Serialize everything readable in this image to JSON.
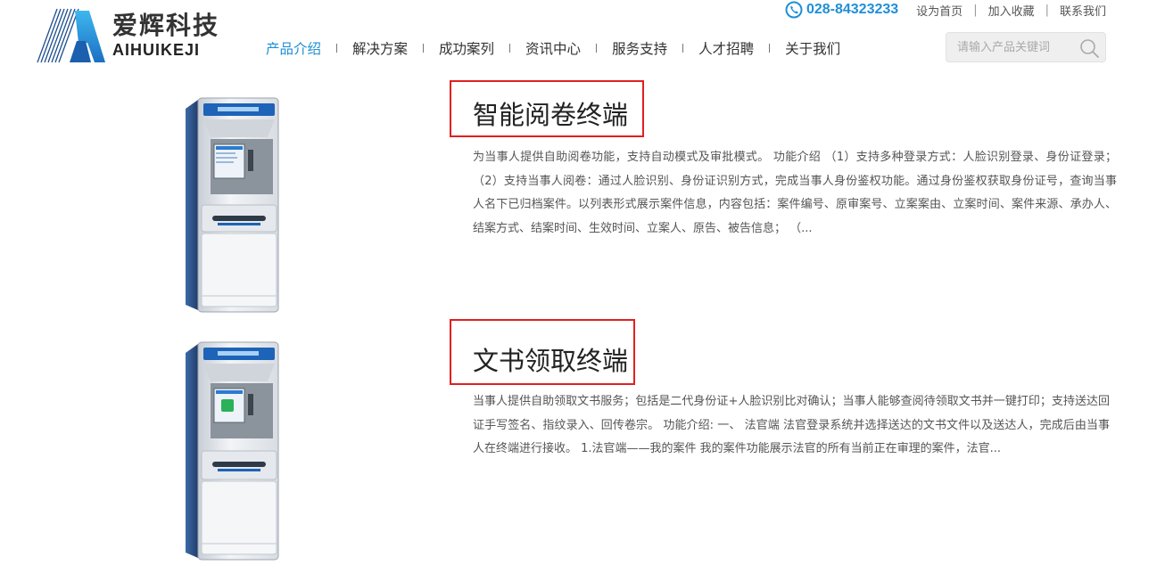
{
  "header": {
    "logo": {
      "cn": "爱辉科技",
      "en": "AIHUIKEJI"
    },
    "phone": "028-84323233",
    "top_links": [
      "设为首页",
      "加入收藏",
      "联系我们"
    ],
    "top_sep": "|",
    "nav": [
      {
        "label": "产品介绍",
        "active": true
      },
      {
        "label": "解决方案"
      },
      {
        "label": "成功案列"
      },
      {
        "label": "资讯中心"
      },
      {
        "label": "服务支持"
      },
      {
        "label": "人才招聘"
      },
      {
        "label": "关于我们"
      }
    ],
    "search": {
      "placeholder": "请输入产品关键词"
    }
  },
  "products": [
    {
      "title": "智能阅卷终端",
      "description": "为当事人提供自助阅卷功能，支持自动模式及审批模式。 功能介绍 （1）支持多种登录方式：人脸识别登录、身份证登录； （2）支持当事人阅卷：通过人脸识别、身份证识别方式，完成当事人身份鉴权功能。通过身份鉴权获取身份证号，查询当事人名下已归档案件。以列表形式展示案件信息，内容包括：案件编号、原审案号、立案案由、立案时间、案件来源、承办人、结案方式、结案时间、生效时间、立案人、原告、被告信息； （..."
    },
    {
      "title": "文书领取终端",
      "description": "当事人提供自助领取文书服务；包括是二代身份证+人脸识别比对确认；当事人能够查阅待领取文书并一键打印；支持送达回证手写签名、指纹录入、回传卷宗。 功能介绍: 一、 法官端 法官登录系统并选择送达的文书文件以及送达人，完成后由当事人在终端进行接收。 1.法官端——我的案件 我的案件功能展示法官的所有当前正在审理的案件，法官..."
    }
  ],
  "colors": {
    "accent": "#1f8fd6",
    "title_border": "#e02020"
  }
}
